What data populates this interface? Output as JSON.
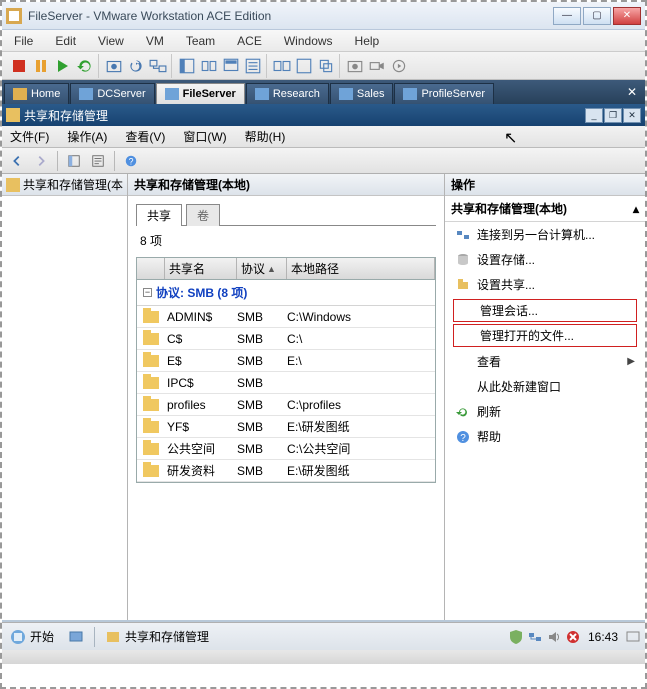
{
  "vmware": {
    "title": "FileServer - VMware Workstation ACE Edition",
    "menu": [
      "File",
      "Edit",
      "View",
      "VM",
      "Team",
      "ACE",
      "Windows",
      "Help"
    ],
    "tabs": [
      {
        "label": "Home",
        "active": false
      },
      {
        "label": "DCServer",
        "active": false
      },
      {
        "label": "FileServer",
        "active": true
      },
      {
        "label": "Research",
        "active": false
      },
      {
        "label": "Sales",
        "active": false
      },
      {
        "label": "ProfileServer",
        "active": false
      }
    ]
  },
  "guest": {
    "title": "共享和存储管理",
    "menu": [
      "文件(F)",
      "操作(A)",
      "查看(V)",
      "窗口(W)",
      "帮助(H)"
    ],
    "left_tree_root": "共享和存储管理(本",
    "center_title": "共享和存储管理(本地)",
    "sub_tabs": {
      "active": "共享",
      "inactive": "卷"
    },
    "item_count": "8 项",
    "columns": {
      "name": "共享名",
      "protocol": "协议",
      "path": "本地路径"
    },
    "section_label": "协议: SMB (8 项)",
    "rows": [
      {
        "name": "ADMIN$",
        "proto": "SMB",
        "path": "C:\\Windows"
      },
      {
        "name": "C$",
        "proto": "SMB",
        "path": "C:\\"
      },
      {
        "name": "E$",
        "proto": "SMB",
        "path": "E:\\"
      },
      {
        "name": "IPC$",
        "proto": "SMB",
        "path": ""
      },
      {
        "name": "profiles",
        "proto": "SMB",
        "path": "C:\\profiles"
      },
      {
        "name": "YF$",
        "proto": "SMB",
        "path": "E:\\研发图纸"
      },
      {
        "name": "公共空间",
        "proto": "SMB",
        "path": "C:\\公共空间"
      },
      {
        "name": "研发资料",
        "proto": "SMB",
        "path": "E:\\研发图纸"
      }
    ],
    "actions": {
      "header": "操作",
      "section": "共享和存储管理(本地)",
      "items": [
        {
          "label": "连接到另一台计算机...",
          "icon": "connect",
          "boxed": false,
          "arrow": false
        },
        {
          "label": "设置存储...",
          "icon": "storage",
          "boxed": false,
          "arrow": false
        },
        {
          "label": "设置共享...",
          "icon": "share",
          "boxed": false,
          "arrow": false
        },
        {
          "label": "管理会话...",
          "icon": "",
          "boxed": true,
          "arrow": false
        },
        {
          "label": "管理打开的文件...",
          "icon": "",
          "boxed": true,
          "arrow": false
        },
        {
          "label": "查看",
          "icon": "",
          "boxed": false,
          "arrow": true
        },
        {
          "label": "从此处新建窗口",
          "icon": "",
          "boxed": false,
          "arrow": false
        },
        {
          "label": "刷新",
          "icon": "refresh",
          "boxed": false,
          "arrow": false
        },
        {
          "label": "帮助",
          "icon": "help",
          "boxed": false,
          "arrow": false
        }
      ]
    },
    "taskbar": {
      "start": "开始",
      "task": "共享和存储管理",
      "clock": "16:43"
    }
  }
}
